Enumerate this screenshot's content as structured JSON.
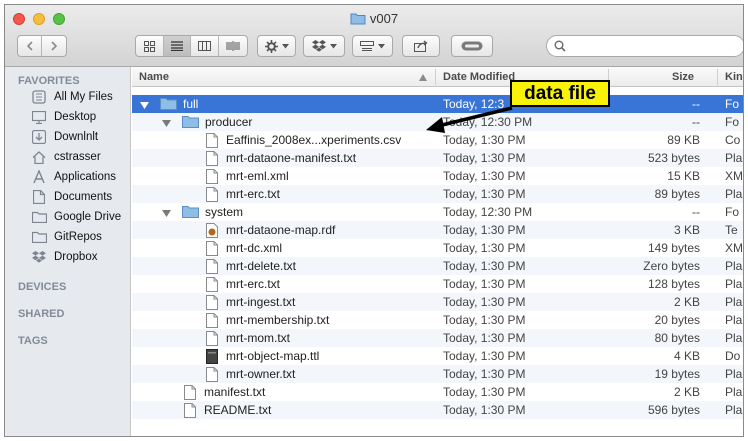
{
  "window": {
    "title": "v007"
  },
  "search": {
    "placeholder": ""
  },
  "sidebar": {
    "favorites_heading": "FAVORITES",
    "devices_heading": "DEVICES",
    "shared_heading": "SHARED",
    "tags_heading": "TAGS",
    "items": [
      {
        "label": "All My Files",
        "icon": "all-files-icon"
      },
      {
        "label": "Desktop",
        "icon": "desktop-icon"
      },
      {
        "label": "Downlnlt",
        "icon": "downloads-icon"
      },
      {
        "label": "cstrasser",
        "icon": "home-icon"
      },
      {
        "label": "Applications",
        "icon": "applications-icon"
      },
      {
        "label": "Documents",
        "icon": "documents-icon"
      },
      {
        "label": "Google Drive",
        "icon": "folder-icon"
      },
      {
        "label": "GitRepos",
        "icon": "folder-icon"
      },
      {
        "label": "Dropbox",
        "icon": "dropbox-icon"
      }
    ]
  },
  "columns": {
    "name": "Name",
    "date": "Date Modified",
    "size": "Size",
    "kind": "Kin"
  },
  "rows": [
    {
      "name": "full",
      "date": "Today, 12:3",
      "size": "--",
      "kind": "Fo",
      "level": 0,
      "type": "folder",
      "expanded": true,
      "selected": true
    },
    {
      "name": "producer",
      "date": "Today, 12:30 PM",
      "size": "--",
      "kind": "Fo",
      "level": 1,
      "type": "folder",
      "expanded": true
    },
    {
      "name": "Eaffinis_2008ex...xperiments.csv",
      "date": "Today, 1:30 PM",
      "size": "89 KB",
      "kind": "Co",
      "level": 2,
      "type": "file"
    },
    {
      "name": "mrt-dataone-manifest.txt",
      "date": "Today, 1:30 PM",
      "size": "523 bytes",
      "kind": "Pla",
      "level": 2,
      "type": "file"
    },
    {
      "name": "mrt-eml.xml",
      "date": "Today, 1:30 PM",
      "size": "15 KB",
      "kind": "XM",
      "level": 2,
      "type": "file"
    },
    {
      "name": "mrt-erc.txt",
      "date": "Today, 1:30 PM",
      "size": "89 bytes",
      "kind": "Pla",
      "level": 2,
      "type": "file"
    },
    {
      "name": "system",
      "date": "Today, 12:30 PM",
      "size": "--",
      "kind": "Fo",
      "level": 1,
      "type": "folder",
      "expanded": true
    },
    {
      "name": "mrt-dataone-map.rdf",
      "date": "Today, 1:30 PM",
      "size": "3 KB",
      "kind": "Te",
      "level": 2,
      "type": "rdf"
    },
    {
      "name": "mrt-dc.xml",
      "date": "Today, 1:30 PM",
      "size": "149 bytes",
      "kind": "XM",
      "level": 2,
      "type": "file"
    },
    {
      "name": "mrt-delete.txt",
      "date": "Today, 1:30 PM",
      "size": "Zero bytes",
      "kind": "Pla",
      "level": 2,
      "type": "file"
    },
    {
      "name": "mrt-erc.txt",
      "date": "Today, 1:30 PM",
      "size": "128 bytes",
      "kind": "Pla",
      "level": 2,
      "type": "file"
    },
    {
      "name": "mrt-ingest.txt",
      "date": "Today, 1:30 PM",
      "size": "2 KB",
      "kind": "Pla",
      "level": 2,
      "type": "file"
    },
    {
      "name": "mrt-membership.txt",
      "date": "Today, 1:30 PM",
      "size": "20 bytes",
      "kind": "Pla",
      "level": 2,
      "type": "file"
    },
    {
      "name": "mrt-mom.txt",
      "date": "Today, 1:30 PM",
      "size": "80 bytes",
      "kind": "Pla",
      "level": 2,
      "type": "file"
    },
    {
      "name": "mrt-object-map.ttl",
      "date": "Today, 1:30 PM",
      "size": "4 KB",
      "kind": "Do",
      "level": 2,
      "type": "dark"
    },
    {
      "name": "mrt-owner.txt",
      "date": "Today, 1:30 PM",
      "size": "19 bytes",
      "kind": "Pla",
      "level": 2,
      "type": "file"
    },
    {
      "name": "manifest.txt",
      "date": "Today, 1:30 PM",
      "size": "2 KB",
      "kind": "Pla",
      "level": 1,
      "type": "file"
    },
    {
      "name": "README.txt",
      "date": "Today, 1:30 PM",
      "size": "596 bytes",
      "kind": "Pla",
      "level": 1,
      "type": "file"
    }
  ],
  "callout": {
    "label": "data file",
    "color": "#f7f207"
  },
  "colors": {
    "selection": "#3875d7",
    "folder": "#6fa8dc"
  }
}
